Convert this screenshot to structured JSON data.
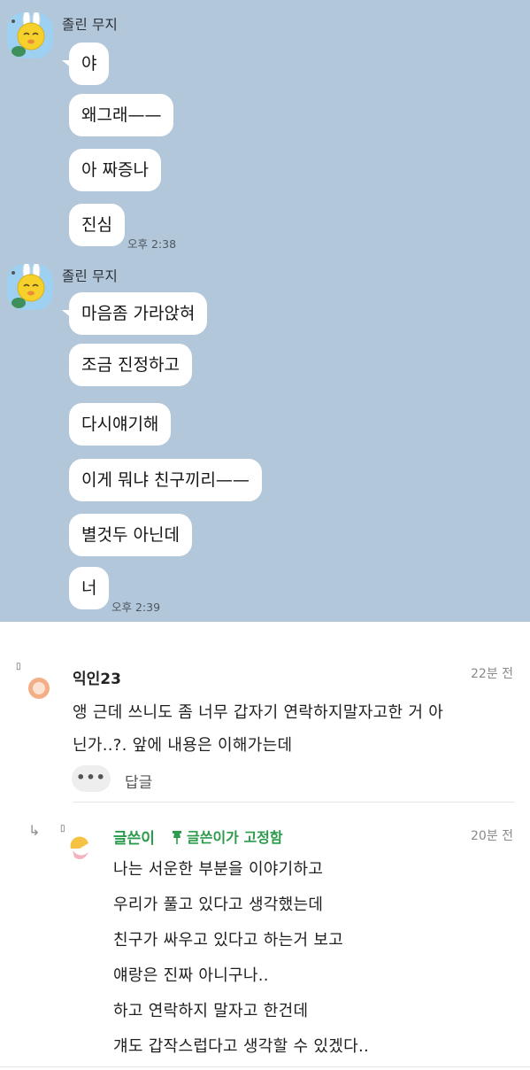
{
  "chat": {
    "groups": [
      {
        "sender": "졸린 무지",
        "messages": [
          "야",
          "왜그래——",
          "아 짜증나",
          "진심"
        ],
        "time": "오후 2:38"
      },
      {
        "sender": "졸린 무지",
        "messages": [
          "마음좀 가라앉혀",
          "조금 진정하고",
          "다시얘기해",
          "이게 뭐냐 친구끼리——",
          "별것두 아닌데",
          "너"
        ],
        "time": "오후 2:39"
      }
    ]
  },
  "comments": {
    "comment": {
      "mark": "▯",
      "name": "익인23",
      "time": "22분 전",
      "lines": [
        "앵 근데 쓰니도 좀 너무 갑자기 연락하지말자고한 거 아",
        "닌가..?. 앞에 내용은 이해가는데"
      ],
      "more_label": "•••",
      "reply_label": "답글"
    },
    "reply": {
      "arrow": "↳",
      "mark": "▯",
      "author": "글쓴이",
      "pin_icon": "pin-icon",
      "pinned_label": "글쓴이가 고정함",
      "time": "20분 전",
      "lines": [
        "나는 서운한 부분을 이야기하고",
        "우리가 풀고 있다고 생각했는데",
        "친구가 싸우고 있다고 하는거 보고",
        "얘랑은 진짜 아니구나..",
        "하고 연락하지 말자고 한건데",
        "걔도 갑작스럽다고 생각할 수 있겠다.."
      ]
    },
    "colors": {
      "chat_bg": "#b2c7d9",
      "author_green": "#2c9b4b"
    }
  }
}
